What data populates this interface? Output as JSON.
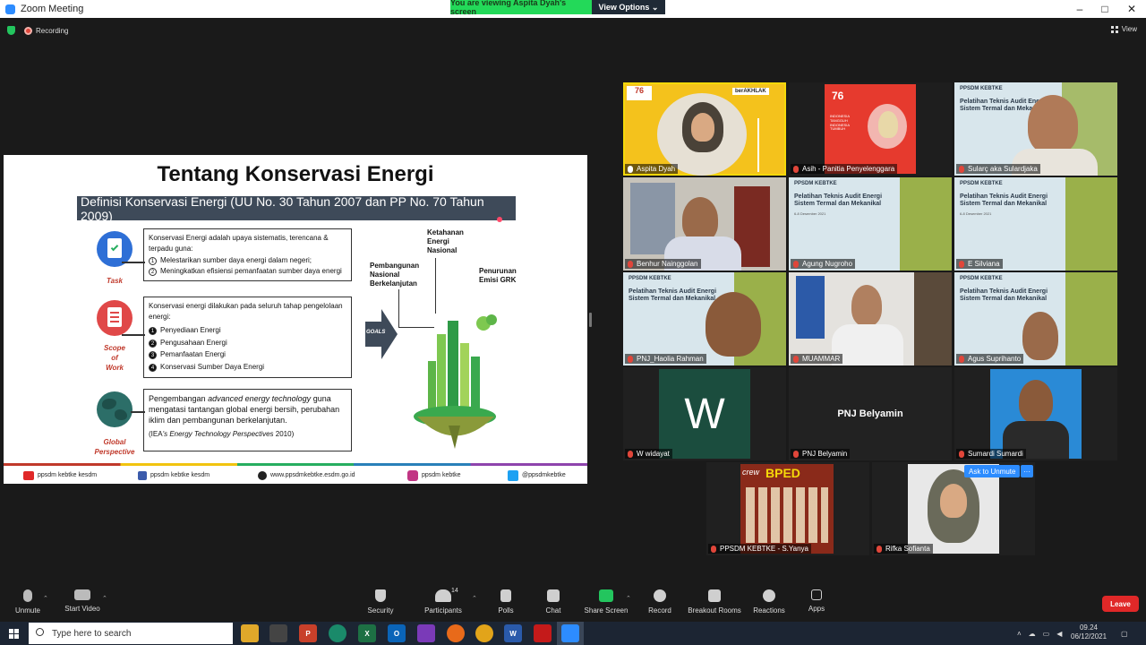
{
  "window": {
    "title": "Zoom Meeting"
  },
  "share_banner": {
    "viewing": "You are viewing Aspita Dyah's screen",
    "view_options": "View Options"
  },
  "top": {
    "recording": "Recording",
    "view": "View"
  },
  "slide": {
    "title": "Tentang Konservasi Energi",
    "definition": "Definisi Konservasi Energi (UU No. 30 Tahun 2007 dan PP No. 70 Tahun 2009)",
    "task": {
      "label": "Task",
      "intro": "Konservasi Energi adalah upaya sistematis, terencana & terpadu guna:",
      "items": [
        {
          "n": "1",
          "text": "Melestarikan sumber daya energi dalam negeri;"
        },
        {
          "n": "2",
          "text": "Meningkatkan efisiensi pemanfaatan sumber daya energi"
        }
      ]
    },
    "scope": {
      "label_1": "Scope",
      "label_2": "of",
      "label_3": "Work",
      "intro": "Konservasi energi dilakukan pada seluruh tahap pengelolaan energi:",
      "items": [
        {
          "n": "1",
          "text": "Penyediaan Energi"
        },
        {
          "n": "2",
          "text": "Pengusahaan Energi"
        },
        {
          "n": "3",
          "text": "Pemanfaatan Energi"
        },
        {
          "n": "4",
          "text": "Konservasi Sumber Daya Energi"
        }
      ]
    },
    "global": {
      "label_1": "Global",
      "label_2": "Perspective",
      "text_pre": "Pengembangan",
      "text_italic": "advanced energy technology",
      "text_post": "guna mengatasi tantangan global energi bersih, perubahan iklim dan pembangunan berkelanjutan.",
      "source_pre": "(IEA",
      "source_italic": "'s Energy Technology Perspectives",
      "source_post": "2010)"
    },
    "goals": {
      "arrow": "GOALS",
      "g1": "Ketahanan\nEnergi\nNasional",
      "g2": "Pembangunan\nNasional\nBerkelanjutan",
      "g3": "Penurunan\nEmisi GRK"
    },
    "footer": {
      "youtube": "ppsdm kebtke kesdm",
      "facebook": "ppsdm kebtke kesdm",
      "web": "www.ppsdmkebtke.esdm.go.id",
      "instagram": "ppsdm kebtke",
      "twitter": "@ppsdmkebtke"
    }
  },
  "participants": [
    {
      "name": "Aspita Dyah",
      "muted": false
    },
    {
      "name": "Asih - Panitia Penyelenggara",
      "muted": true
    },
    {
      "name": "Sularç aka Sulardjaka",
      "muted": true
    },
    {
      "name": "Benhur Nainggolan",
      "muted": true
    },
    {
      "name": "Agung Nugroho",
      "muted": true
    },
    {
      "name": "E Silviana",
      "muted": true
    },
    {
      "name": "PNJ_Haolia Rahman",
      "muted": true
    },
    {
      "name": "MUAMMAR",
      "muted": true
    },
    {
      "name": "Agus Suprihanto",
      "muted": true
    },
    {
      "name": "W widayat",
      "muted": true,
      "initial": "W"
    },
    {
      "name": "PNJ Belyamin",
      "muted": true,
      "display": "PNJ Belyamin"
    },
    {
      "name": "Sumardi Sumardi",
      "muted": true
    },
    {
      "name": "PPSDM KEBTKE - S.Yanya",
      "muted": true
    },
    {
      "name": "Rifka Sofianta",
      "muted": true
    }
  ],
  "tile_texts": {
    "pelatihan": "Pelatihan Teknis Audit Energi\nSistem Termal dan Mekanikal",
    "date": "6-8 Desember 2021",
    "ppsdm": "PPSDM KEBTKE",
    "asih_slide": "INDONESIA TANGGUH INDONESIA TUMBUH",
    "berakhlak": "berAKHLAK",
    "bped": "BPED",
    "crew": "crew"
  },
  "popups": {
    "ask_unmute": "Ask to Unmute",
    "more": "···"
  },
  "toolbar": {
    "unmute": "Unmute",
    "start_video": "Start Video",
    "security": "Security",
    "participants": "Participants",
    "participants_count": "14",
    "polls": "Polls",
    "chat": "Chat",
    "share_screen": "Share Screen",
    "record": "Record",
    "breakout": "Breakout Rooms",
    "reactions": "Reactions",
    "apps": "Apps",
    "leave": "Leave"
  },
  "taskbar": {
    "search_placeholder": "Type here to search",
    "time": "09.24",
    "date": "06/12/2021"
  },
  "colors": {
    "zoom_blue": "#2d8cff",
    "share_green": "#23d959",
    "leave_red": "#e02828",
    "speaker_yellow": "#f5d80a"
  }
}
